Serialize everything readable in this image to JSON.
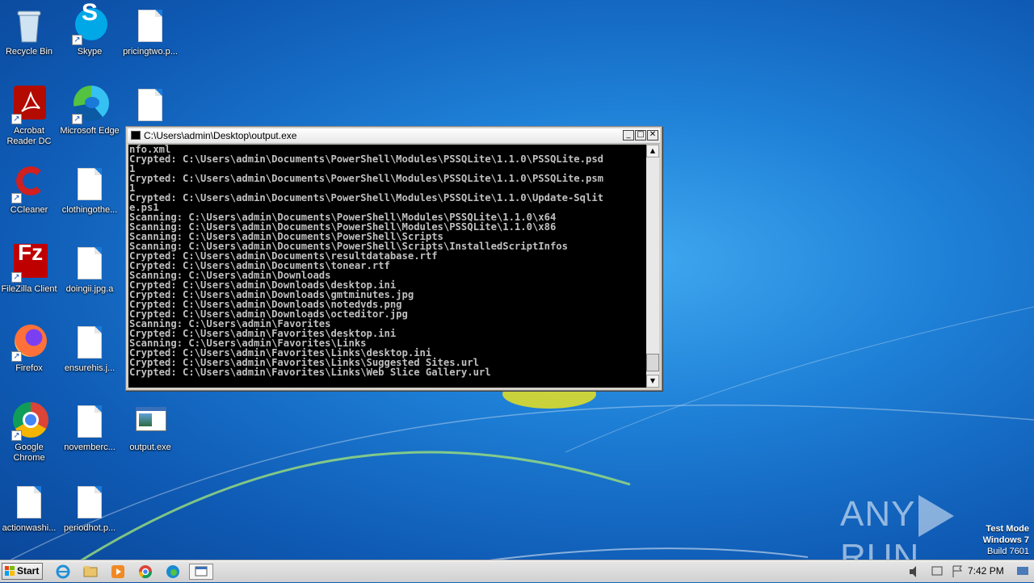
{
  "desktop": {
    "icons": [
      {
        "label": "Recycle Bin",
        "icon": "recycle-bin-icon"
      },
      {
        "label": "Skype",
        "icon": "skype-icon"
      },
      {
        "label": "pricingtwo.p...",
        "icon": "document-icon"
      },
      {
        "label": "Acrobat Reader DC",
        "icon": "acrobat-icon"
      },
      {
        "label": "Microsoft Edge",
        "icon": "edge-icon"
      },
      {
        "label": "",
        "icon": "document-icon"
      },
      {
        "label": "CCleaner",
        "icon": "ccleaner-icon"
      },
      {
        "label": "clothingothe...",
        "icon": "document-icon"
      },
      {
        "label": "FileZilla Client",
        "icon": "filezilla-icon"
      },
      {
        "label": "doingii.jpg.a",
        "icon": "document-icon"
      },
      {
        "label": "Firefox",
        "icon": "firefox-icon"
      },
      {
        "label": "ensurehis.j...",
        "icon": "document-icon"
      },
      {
        "label": "Google Chrome",
        "icon": "chrome-icon"
      },
      {
        "label": "novemberc...",
        "icon": "document-icon"
      },
      {
        "label": "output.exe",
        "icon": "exe-icon"
      },
      {
        "label": "actionwashi...",
        "icon": "document-icon"
      },
      {
        "label": "periodhot.p...",
        "icon": "document-icon"
      }
    ]
  },
  "console_window": {
    "title": "C:\\Users\\admin\\Desktop\\output.exe",
    "buttons": {
      "minimize": "_",
      "maximize": "□",
      "close": "✕"
    },
    "lines": [
      "nfo.xml",
      "Crypted: C:\\Users\\admin\\Documents\\PowerShell\\Modules\\PSSQLite\\1.1.0\\PSSQLite.psd",
      "1",
      "Crypted: C:\\Users\\admin\\Documents\\PowerShell\\Modules\\PSSQLite\\1.1.0\\PSSQLite.psm",
      "1",
      "Crypted: C:\\Users\\admin\\Documents\\PowerShell\\Modules\\PSSQLite\\1.1.0\\Update-Sqlit",
      "e.ps1",
      "Scanning: C:\\Users\\admin\\Documents\\PowerShell\\Modules\\PSSQLite\\1.1.0\\x64",
      "Scanning: C:\\Users\\admin\\Documents\\PowerShell\\Modules\\PSSQLite\\1.1.0\\x86",
      "Scanning: C:\\Users\\admin\\Documents\\PowerShell\\Scripts",
      "Scanning: C:\\Users\\admin\\Documents\\PowerShell\\Scripts\\InstalledScriptInfos",
      "Crypted: C:\\Users\\admin\\Documents\\resultdatabase.rtf",
      "Crypted: C:\\Users\\admin\\Documents\\tonear.rtf",
      "Scanning: C:\\Users\\admin\\Downloads",
      "Crypted: C:\\Users\\admin\\Downloads\\desktop.ini",
      "Crypted: C:\\Users\\admin\\Downloads\\gmtminutes.jpg",
      "Crypted: C:\\Users\\admin\\Downloads\\notedvds.png",
      "Crypted: C:\\Users\\admin\\Downloads\\octeditor.jpg",
      "Scanning: C:\\Users\\admin\\Favorites",
      "Crypted: C:\\Users\\admin\\Favorites\\desktop.ini",
      "Scanning: C:\\Users\\admin\\Favorites\\Links",
      "Crypted: C:\\Users\\admin\\Favorites\\Links\\desktop.ini",
      "Crypted: C:\\Users\\admin\\Favorites\\Links\\Suggested Sites.url",
      "Crypted: C:\\Users\\admin\\Favorites\\Links\\Web Slice Gallery.url"
    ]
  },
  "watermark": {
    "brand_left": "ANY",
    "brand_right": "RUN",
    "test_mode": "Test Mode",
    "os": "Windows 7",
    "build": "Build 7601"
  },
  "taskbar": {
    "start_label": "Start",
    "pinned": [
      "ie-icon",
      "explorer-icon",
      "media-player-icon",
      "chrome-icon",
      "edge-icon",
      "console-icon"
    ],
    "clock": "7:42 PM"
  }
}
